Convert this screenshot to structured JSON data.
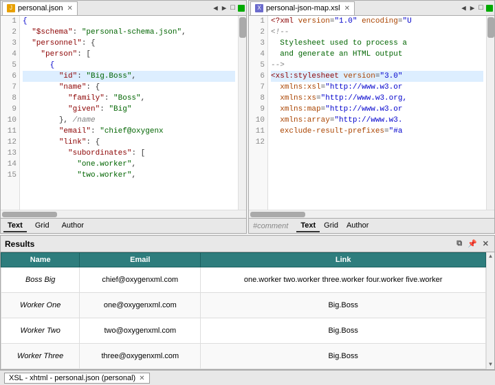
{
  "editors": {
    "left": {
      "tab_label": "personal.json",
      "tab_icon_type": "json",
      "lines": [
        {
          "num": 1,
          "content": "{",
          "highlight": false
        },
        {
          "num": 2,
          "content": "  \"$schema\": \"personal-schema.json\",",
          "highlight": false
        },
        {
          "num": 3,
          "content": "  \"personnel\": {",
          "highlight": false
        },
        {
          "num": 4,
          "content": "    \"person\": [",
          "highlight": false
        },
        {
          "num": 5,
          "content": "      {",
          "highlight": false
        },
        {
          "num": 6,
          "content": "        \"id\": \"Big.Boss\",",
          "highlight": true
        },
        {
          "num": 7,
          "content": "        \"name\": {",
          "highlight": false
        },
        {
          "num": 8,
          "content": "          \"family\": \"Boss\",",
          "highlight": false
        },
        {
          "num": 9,
          "content": "          \"given\": \"Big\"",
          "highlight": false
        },
        {
          "num": 10,
          "content": "        }, /name",
          "highlight": false
        },
        {
          "num": 11,
          "content": "        \"email\": \"chief@oxygenx",
          "highlight": false
        },
        {
          "num": 12,
          "content": "        \"link\": {",
          "highlight": false
        },
        {
          "num": 13,
          "content": "          \"subordinates\": [",
          "highlight": false
        },
        {
          "num": 14,
          "content": "            \"one.worker\",",
          "highlight": false
        },
        {
          "num": 15,
          "content": "            \"two.worker\",",
          "highlight": false
        }
      ],
      "bottom_tabs": [
        "Text",
        "Grid",
        "Author"
      ],
      "active_bottom_tab": "Text"
    },
    "right": {
      "tab_label": "personal-json-map.xsl",
      "tab_icon_type": "xsl",
      "lines": [
        {
          "num": 1,
          "content": "<?xml version=\"1.0\" encoding=\"U",
          "highlight": false
        },
        {
          "num": 2,
          "content": "<!--",
          "highlight": false
        },
        {
          "num": 3,
          "content": "  Stylesheet used to process a",
          "highlight": false
        },
        {
          "num": 4,
          "content": "  and generate an HTML output",
          "highlight": false
        },
        {
          "num": 5,
          "content": "-->",
          "highlight": false
        },
        {
          "num": 6,
          "content": "<xsl:stylesheet version=\"3.0\"",
          "highlight": true
        },
        {
          "num": 7,
          "content": "  xmlns:xsl=\"http://www.w3.or",
          "highlight": false
        },
        {
          "num": 8,
          "content": "  xmlns:xs=\"http://www.w3.org,",
          "highlight": false
        },
        {
          "num": 9,
          "content": "  xmlns:map=\"http://www.w3.or",
          "highlight": false
        },
        {
          "num": 10,
          "content": "  xmlns:array=\"http://www.w3.",
          "highlight": false
        },
        {
          "num": 11,
          "content": "  exclude-result-prefixes=\"#a",
          "highlight": false
        },
        {
          "num": 12,
          "content": "",
          "highlight": false
        }
      ],
      "comment_label": "#comment",
      "bottom_tabs": [
        "Text",
        "Grid",
        "Author"
      ],
      "active_bottom_tab": "Text"
    }
  },
  "results": {
    "panel_title": "Results",
    "columns": [
      "Name",
      "Email",
      "Link"
    ],
    "rows": [
      {
        "name": "Boss Big",
        "email": "chief@oxygenxml.com",
        "link": "one.worker two.worker three.worker four.worker five.worker"
      },
      {
        "name": "Worker One",
        "email": "one@oxygenxml.com",
        "link": "Big.Boss"
      },
      {
        "name": "Worker Two",
        "email": "two@oxygenxml.com",
        "link": "Big.Boss"
      },
      {
        "name": "Worker Three",
        "email": "three@oxygenxml.com",
        "link": "Big.Boss"
      }
    ],
    "header_buttons": {
      "restore": "⧉",
      "pin": "📌",
      "close": "✕"
    }
  },
  "status_bar": {
    "label": "XSL - xhtml - personal.json (personal)",
    "close": "✕"
  },
  "icons": {
    "triangle_left": "◀",
    "triangle_right": "▶",
    "maximize": "□",
    "close": "✕",
    "scroll_up": "▲",
    "scroll_down": "▼",
    "scroll_left": "◀",
    "scroll_right": "▶"
  }
}
